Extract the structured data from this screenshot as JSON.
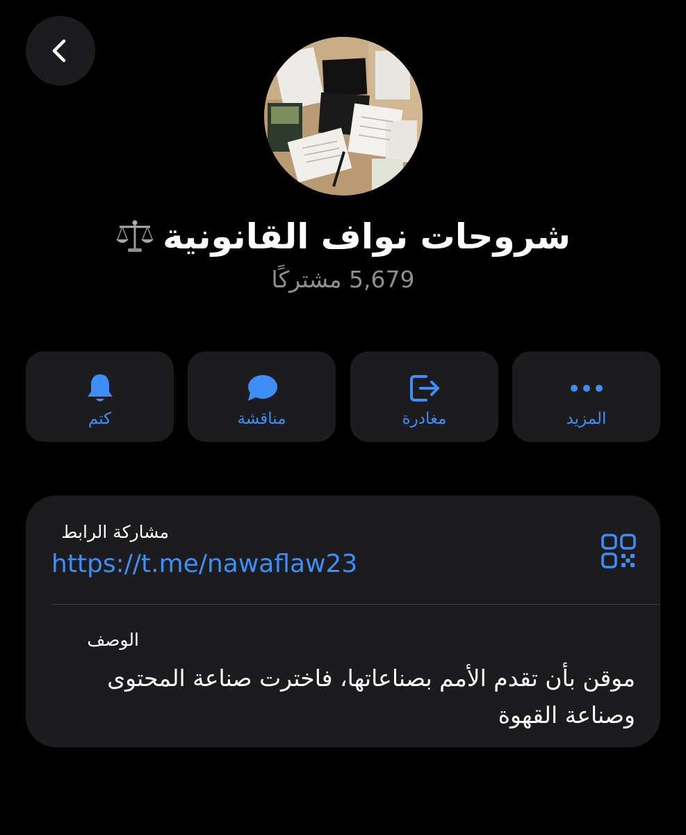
{
  "header": {
    "back_icon": "chevron-left-icon"
  },
  "channel": {
    "avatar_icon": "channel-photo-desk-laptop",
    "title": "شروحات نواف القانونية",
    "title_emoji": "balance-scale-icon",
    "subscribers": "5,679 مشتركًا"
  },
  "actions": [
    {
      "label": "كتم",
      "icon": "bell-icon"
    },
    {
      "label": "مناقشة",
      "icon": "chat-bubble-icon"
    },
    {
      "label": "مغادرة",
      "icon": "leave-icon"
    },
    {
      "label": "المزيد",
      "icon": "more-dots-icon"
    }
  ],
  "info": {
    "link_title": "مشاركة الرابط",
    "link_url": "https://t.me/nawaflaw23",
    "qr_icon": "qr-code-icon",
    "description_title": "الوصف",
    "description": "موقن بأن تقدم الأمم بصناعاتها، فاخترت صناعة المحتوى وصناعة القهوة"
  },
  "colors": {
    "background": "#000000",
    "card": "#1c1c1e",
    "accent": "#3e8ef7",
    "secondary_text": "#8e8e93",
    "divider": "#38383a"
  }
}
